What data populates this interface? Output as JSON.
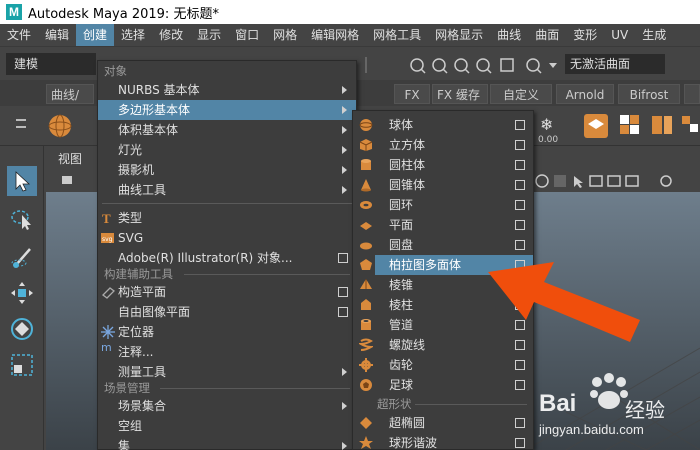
{
  "window": {
    "logo_letter": "M",
    "title": "Autodesk Maya 2019: 无标题*"
  },
  "menubar": {
    "items": [
      "文件",
      "编辑",
      "创建",
      "选择",
      "修改",
      "显示",
      "窗口",
      "网格",
      "编辑网格",
      "网格工具",
      "网格显示",
      "曲线",
      "曲面",
      "变形",
      "UV",
      "生成"
    ],
    "active_index": 2
  },
  "statusline": {
    "mode": "建模",
    "no_active_surface": "无激活曲面"
  },
  "shelf": {
    "tabs": [
      "曲线/",
      "FX",
      "FX 缓存",
      "自定义",
      "Arnold",
      "Bifrost"
    ]
  },
  "viewport": {
    "panel_menu": "视图"
  },
  "create_menu": {
    "section_objects": "对象",
    "items_objects": [
      {
        "label": "NURBS 基本体",
        "submenu": true
      },
      {
        "label": "多边形基本体",
        "submenu": true,
        "highlighted": true
      },
      {
        "label": "体积基本体",
        "submenu": true
      },
      {
        "label": "灯光",
        "submenu": true
      },
      {
        "label": "摄影机",
        "submenu": true
      },
      {
        "label": "曲线工具",
        "submenu": true
      }
    ],
    "items_type": [
      {
        "label": "类型",
        "icon": "T"
      },
      {
        "label": "SVG",
        "icon": "svg"
      },
      {
        "label": "Adobe(R) Illustrator(R) 对象...",
        "option": true
      }
    ],
    "section_construction": "构建辅助工具",
    "items_construction": [
      {
        "label": "构造平面",
        "option": true
      },
      {
        "label": "自由图像平面",
        "option": true
      },
      {
        "label": "定位器"
      },
      {
        "label": "注释..."
      },
      {
        "label": "测量工具",
        "submenu": true
      }
    ],
    "section_scene": "场景管理",
    "items_scene": [
      {
        "label": "场景集合",
        "submenu": true
      },
      {
        "label": "空组"
      },
      {
        "label": "集",
        "submenu": true
      }
    ]
  },
  "poly_submenu": {
    "items": [
      {
        "label": "球体",
        "icon": "sphere-icon"
      },
      {
        "label": "立方体",
        "icon": "cube-icon"
      },
      {
        "label": "圆柱体",
        "icon": "cylinder-icon"
      },
      {
        "label": "圆锥体",
        "icon": "cone-icon"
      },
      {
        "label": "圆环",
        "icon": "torus-icon"
      },
      {
        "label": "平面",
        "icon": "plane-icon"
      },
      {
        "label": "圆盘",
        "icon": "disc-icon"
      },
      {
        "label": "柏拉图多面体",
        "icon": "platonic-icon",
        "highlighted": true
      },
      {
        "label": "棱锥",
        "icon": "pyramid-icon"
      },
      {
        "label": "棱柱",
        "icon": "prism-icon"
      },
      {
        "label": "管道",
        "icon": "pipe-icon"
      },
      {
        "label": "螺旋线",
        "icon": "helix-icon"
      },
      {
        "label": "齿轮",
        "icon": "gear-icon"
      },
      {
        "label": "足球",
        "icon": "soccer-ball-icon"
      }
    ],
    "section_super": "超形状",
    "items_super": [
      {
        "label": "超椭圆",
        "icon": "super-ellipse-icon"
      },
      {
        "label": "球形谐波",
        "icon": "spherical-harmonics-icon"
      }
    ]
  },
  "watermark": {
    "brand": "Bai",
    "brand_cn": "经验",
    "url": "jingyan.baidu.com"
  },
  "colors": {
    "highlight": "#5285a6",
    "menu_bg": "#3d3d3d",
    "annotation_arrow": "#f04e0c"
  }
}
